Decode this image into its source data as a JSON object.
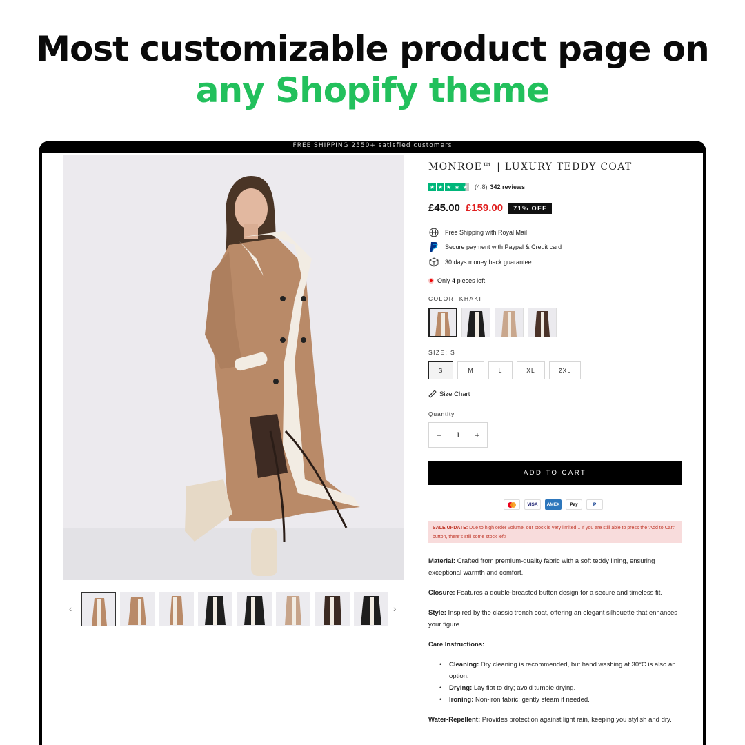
{
  "headline": {
    "line1": "Most customizable product page on",
    "line2": "any Shopify theme"
  },
  "announcement": "FREE SHIPPING 2550+ satisfied customers",
  "product": {
    "title": "MONROE™ | LUXURY TEDDY COAT",
    "rating": {
      "stars": 4.5,
      "score_text": "(4.8)",
      "reviews_text": "342 reviews"
    },
    "price": "£45.00",
    "compare_price": "£159.00",
    "discount_badge": "71% OFF",
    "features": [
      {
        "icon": "globe-icon",
        "text": "Free Shipping with Royal Mail"
      },
      {
        "icon": "paypal-icon",
        "text": "Secure payment with Paypal & Credit card"
      },
      {
        "icon": "box-icon",
        "text": "30 days money back guarantee"
      }
    ],
    "stock": {
      "prefix": "Only",
      "count": "4",
      "suffix": "pieces left"
    },
    "color_label": "COLOR: KHAKI",
    "colors": [
      "Khaki",
      "Black",
      "Beige",
      "Brown"
    ],
    "size_label": "SIZE: S",
    "sizes": [
      "S",
      "M",
      "L",
      "XL",
      "2XL"
    ],
    "selected_size": "S",
    "size_chart_label": "Size Chart",
    "quantity_label": "Quantity",
    "quantity": "1",
    "qty_minus": "−",
    "qty_plus": "+",
    "add_to_cart": "ADD TO CART",
    "payment_methods": [
      "Mastercard",
      "VISA",
      "AMEX",
      "Apple Pay",
      "PayPal"
    ],
    "sale_update": {
      "label": "SALE UPDATE:",
      "text": "Due to high order volume, our stock is very limited... If you are still able to press the 'Add to Cart' button, there's still some stock left!"
    },
    "description": {
      "material_label": "Material:",
      "material": "Crafted from premium-quality fabric with a soft teddy lining, ensuring exceptional warmth and comfort.",
      "closure_label": "Closure:",
      "closure": "Features a double-breasted button design for a secure and timeless fit.",
      "style_label": "Style:",
      "style": "Inspired by the classic trench coat, offering an elegant silhouette that enhances your figure.",
      "care_label": "Care Instructions:",
      "care": [
        {
          "label": "Cleaning:",
          "text": "Dry cleaning is recommended, but hand washing at 30°C is also an option."
        },
        {
          "label": "Drying:",
          "text": "Lay flat to dry; avoid tumble drying."
        },
        {
          "label": "Ironing:",
          "text": "Non-iron fabric; gently steam if needed."
        }
      ],
      "water_label": "Water-Repellent:",
      "water": "Provides protection against light rain, keeping you stylish and dry."
    }
  },
  "gallery": {
    "thumbnail_count": 8,
    "active_index": 0,
    "prev_icon": "chevron-left-icon",
    "next_icon": "chevron-right-icon"
  },
  "colors_palette": {
    "accent_green": "#22c05c",
    "trustpilot_green": "#00b67a",
    "sale_red": "#e02020",
    "sale_bg": "#f8dcdc"
  }
}
